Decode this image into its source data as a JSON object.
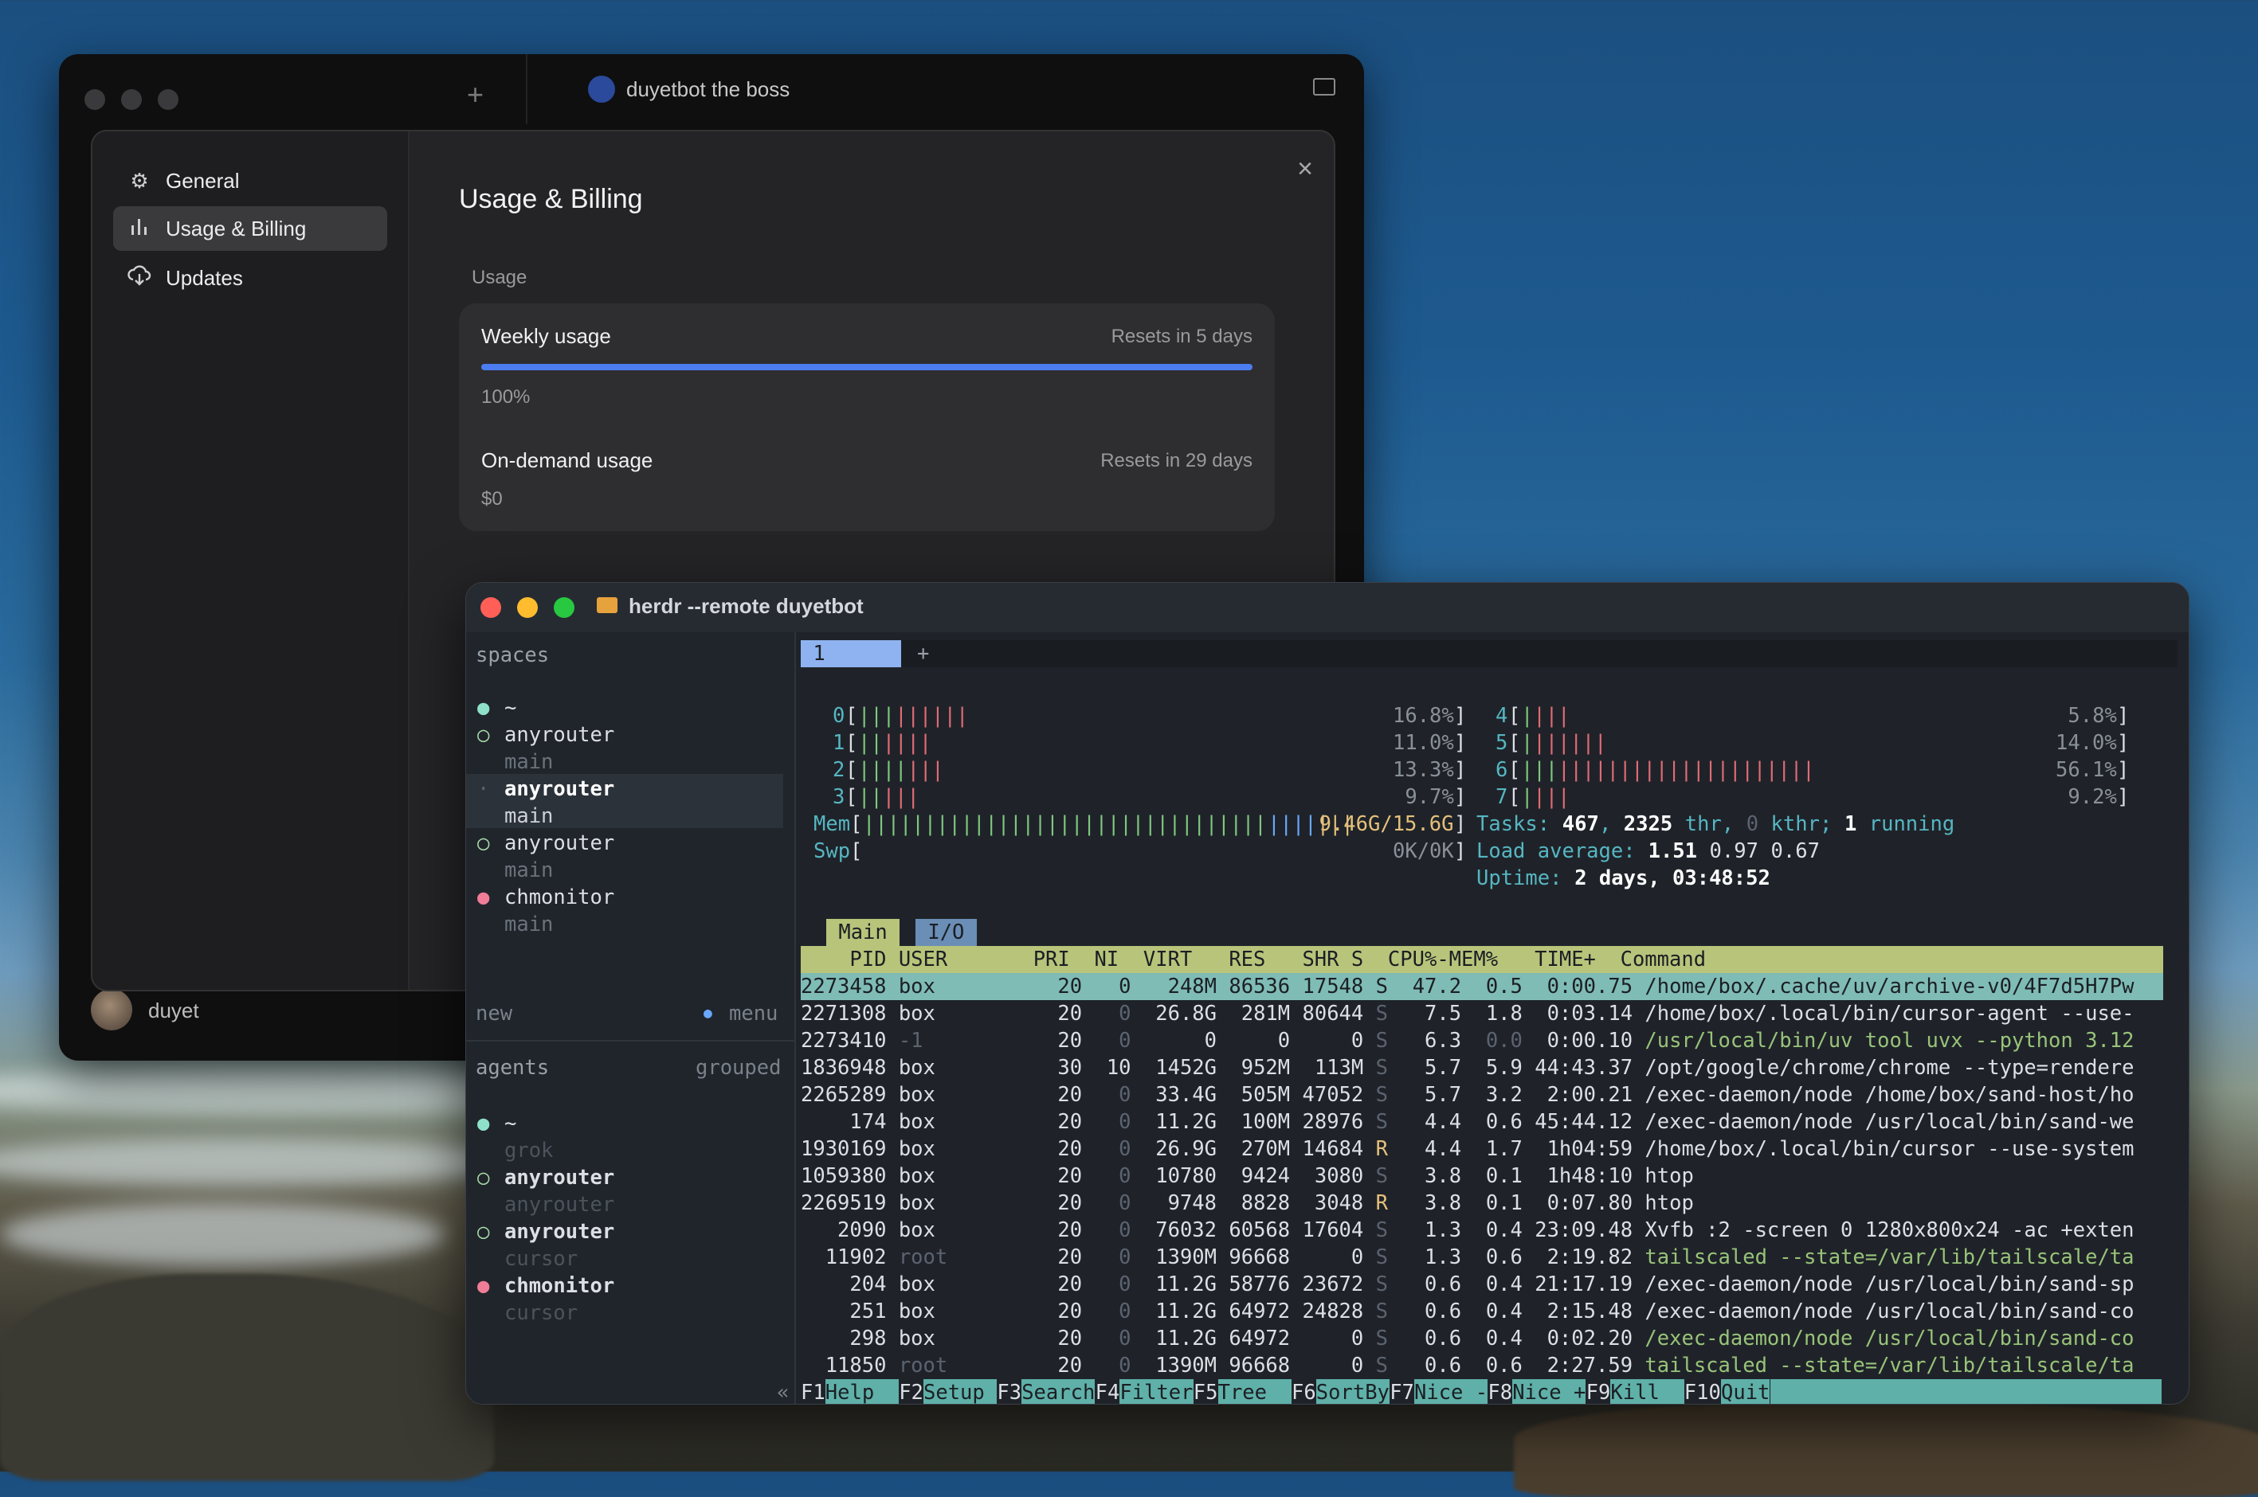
{
  "settings_window": {
    "tab_title": "duyetbot the boss",
    "new_tab_icon": "plus-icon",
    "display_icon": "monitor-icon",
    "sidebar": {
      "items": [
        {
          "label": "General",
          "icon": "gear-icon"
        },
        {
          "label": "Usage & Billing",
          "icon": "bar-chart-icon"
        },
        {
          "label": "Updates",
          "icon": "cloud-download-icon"
        }
      ],
      "active": "Usage & Billing"
    },
    "user_name": "duyet",
    "page_title": "Usage & Billing",
    "section_label": "Usage",
    "weekly": {
      "title": "Weekly usage",
      "reset": "Resets in 5 days",
      "value": "100%",
      "progress": 1.0
    },
    "ondemand": {
      "title": "On-demand usage",
      "reset": "Resets in 29 days",
      "value": "$0"
    },
    "accent_color": "#4c7df0"
  },
  "terminal_window": {
    "title": "herdr --remote duyetbot",
    "spaces_header": "spaces",
    "spaces": [
      {
        "dot": "●",
        "name": "~",
        "sub": ""
      },
      {
        "dot": "○",
        "name": "anyrouter",
        "sub": "main"
      },
      {
        "dot": "·",
        "name": "anyrouter",
        "sub": "main"
      },
      {
        "dot": "○",
        "name": "anyrouter",
        "sub": "main"
      },
      {
        "dot": "●",
        "name": "chmonitor",
        "sub": "main"
      }
    ],
    "new_label": "new",
    "menu_label": "menu",
    "agents_header": "agents",
    "agents_mode": "grouped",
    "agents": [
      {
        "dot": "●",
        "name": "~",
        "sub": "grok"
      },
      {
        "dot": "○",
        "name": "anyrouter",
        "sub": "anyrouter"
      },
      {
        "dot": "○",
        "name": "anyrouter",
        "sub": "cursor"
      },
      {
        "dot": "●",
        "name": "chmonitor",
        "sub": "cursor"
      }
    ],
    "collapse_glyph": "«",
    "tab_active": "1",
    "tab_add": "+",
    "cpus": [
      {
        "id": "0",
        "pct": "16.8%"
      },
      {
        "id": "1",
        "pct": "11.0%"
      },
      {
        "id": "2",
        "pct": "13.3%"
      },
      {
        "id": "3",
        "pct": "9.7%"
      },
      {
        "id": "4",
        "pct": "5.8%"
      },
      {
        "id": "5",
        "pct": "14.0%"
      },
      {
        "id": "6",
        "pct": "56.1%"
      },
      {
        "id": "7",
        "pct": "9.2%"
      }
    ],
    "mem_label": "Mem",
    "mem_value": "9.46G/15.6G",
    "swp_label": "Swp",
    "swp_value": "0K/0K",
    "tasks_line": [
      "Tasks: ",
      "467",
      ", ",
      "2325",
      " thr, ",
      "0",
      " kthr; ",
      "1",
      " running"
    ],
    "load_line": [
      "Load average: ",
      "1.51",
      " 0.97",
      " 0.67"
    ],
    "uptime_line": [
      "Uptime: ",
      "2 days, 03:48:52"
    ],
    "view_tabs": [
      "Main",
      "I/O"
    ],
    "columns": "    PID USER       PRI  NI  VIRT   RES   SHR S  CPU%-MEM%   TIME+  Command",
    "processes": [
      {
        "pid": "2273458",
        "user": "box",
        "pri": "20",
        "ni": "0",
        "virt": "248M",
        "res": "86536",
        "shr": "17548",
        "s": "S",
        "cpu": "47.2",
        "mem": "0.5",
        "time": "0:00.75",
        "cmd": "/home/box/.cache/uv/archive-v0/4F7d5H7Pw"
      },
      {
        "pid": "2271308",
        "user": "box",
        "pri": "20",
        "ni": "0",
        "virt": "26.8G",
        "res": "281M",
        "shr": "80644",
        "s": "S",
        "cpu": "7.5",
        "mem": "1.8",
        "time": "0:03.14",
        "cmd": "/home/box/.local/bin/cursor-agent --use-"
      },
      {
        "pid": "2273410",
        "user": "-1",
        "pri": "20",
        "ni": "0",
        "virt": "0",
        "res": "0",
        "shr": "0",
        "s": "S",
        "cpu": "6.3",
        "mem": "0.0",
        "time": "0:00.10",
        "cmd": "/usr/local/bin/uv tool uvx --python 3.12"
      },
      {
        "pid": "1836948",
        "user": "box",
        "pri": "30",
        "ni": "10",
        "virt": "1452G",
        "res": "952M",
        "shr": "113M",
        "s": "S",
        "cpu": "5.7",
        "mem": "5.9",
        "time": "44:43.37",
        "cmd": "/opt/google/chrome/chrome --type=rendere"
      },
      {
        "pid": "2265289",
        "user": "box",
        "pri": "20",
        "ni": "0",
        "virt": "33.4G",
        "res": "505M",
        "shr": "47052",
        "s": "S",
        "cpu": "5.7",
        "mem": "3.2",
        "time": "2:00.21",
        "cmd": "/exec-daemon/node /home/box/sand-host/ho"
      },
      {
        "pid": "174",
        "user": "box",
        "pri": "20",
        "ni": "0",
        "virt": "11.2G",
        "res": "100M",
        "shr": "28976",
        "s": "S",
        "cpu": "4.4",
        "mem": "0.6",
        "time": "45:44.12",
        "cmd": "/exec-daemon/node /usr/local/bin/sand-we"
      },
      {
        "pid": "1930169",
        "user": "box",
        "pri": "20",
        "ni": "0",
        "virt": "26.9G",
        "res": "270M",
        "shr": "14684",
        "s": "R",
        "cpu": "4.4",
        "mem": "1.7",
        "time": "1h04:59",
        "cmd": "/home/box/.local/bin/cursor --use-system"
      },
      {
        "pid": "1059380",
        "user": "box",
        "pri": "20",
        "ni": "0",
        "virt": "10780",
        "res": "9424",
        "shr": "3080",
        "s": "S",
        "cpu": "3.8",
        "mem": "0.1",
        "time": "1h48:10",
        "cmd": "htop"
      },
      {
        "pid": "2269519",
        "user": "box",
        "pri": "20",
        "ni": "0",
        "virt": "9748",
        "res": "8828",
        "shr": "3048",
        "s": "R",
        "cpu": "3.8",
        "mem": "0.1",
        "time": "0:07.80",
        "cmd": "htop"
      },
      {
        "pid": "2090",
        "user": "box",
        "pri": "20",
        "ni": "0",
        "virt": "76032",
        "res": "60568",
        "shr": "17604",
        "s": "S",
        "cpu": "1.3",
        "mem": "0.4",
        "time": "23:09.48",
        "cmd": "Xvfb :2 -screen 0 1280x800x24 -ac +exten"
      },
      {
        "pid": "11902",
        "user": "root",
        "pri": "20",
        "ni": "0",
        "virt": "1390M",
        "res": "96668",
        "shr": "0",
        "s": "S",
        "cpu": "1.3",
        "mem": "0.6",
        "time": "2:19.82",
        "cmd": "tailscaled --state=/var/lib/tailscale/ta"
      },
      {
        "pid": "204",
        "user": "box",
        "pri": "20",
        "ni": "0",
        "virt": "11.2G",
        "res": "58776",
        "shr": "23672",
        "s": "S",
        "cpu": "0.6",
        "mem": "0.4",
        "time": "21:17.19",
        "cmd": "/exec-daemon/node /usr/local/bin/sand-sp"
      },
      {
        "pid": "251",
        "user": "box",
        "pri": "20",
        "ni": "0",
        "virt": "11.2G",
        "res": "64972",
        "shr": "24828",
        "s": "S",
        "cpu": "0.6",
        "mem": "0.4",
        "time": "2:15.48",
        "cmd": "/exec-daemon/node /usr/local/bin/sand-co"
      },
      {
        "pid": "298",
        "user": "box",
        "pri": "20",
        "ni": "0",
        "virt": "11.2G",
        "res": "64972",
        "shr": "0",
        "s": "S",
        "cpu": "0.6",
        "mem": "0.4",
        "time": "0:02.20",
        "cmd": "/exec-daemon/node /usr/local/bin/sand-co"
      },
      {
        "pid": "11850",
        "user": "root",
        "pri": "20",
        "ni": "0",
        "virt": "1390M",
        "res": "96668",
        "shr": "0",
        "s": "S",
        "cpu": "0.6",
        "mem": "0.6",
        "time": "2:27.59",
        "cmd": "tailscaled --state=/var/lib/tailscale/ta"
      }
    ],
    "fkeys": [
      {
        "key": "F1",
        "label": "Help  "
      },
      {
        "key": "F2",
        "label": "Setup "
      },
      {
        "key": "F3",
        "label": "Search"
      },
      {
        "key": "F4",
        "label": "Filter"
      },
      {
        "key": "F5",
        "label": "Tree  "
      },
      {
        "key": "F6",
        "label": "SortBy"
      },
      {
        "key": "F7",
        "label": "Nice -"
      },
      {
        "key": "F8",
        "label": "Nice +"
      },
      {
        "key": "F9",
        "label": "Kill  "
      },
      {
        "key": "F10",
        "label": "Quit"
      }
    ]
  }
}
